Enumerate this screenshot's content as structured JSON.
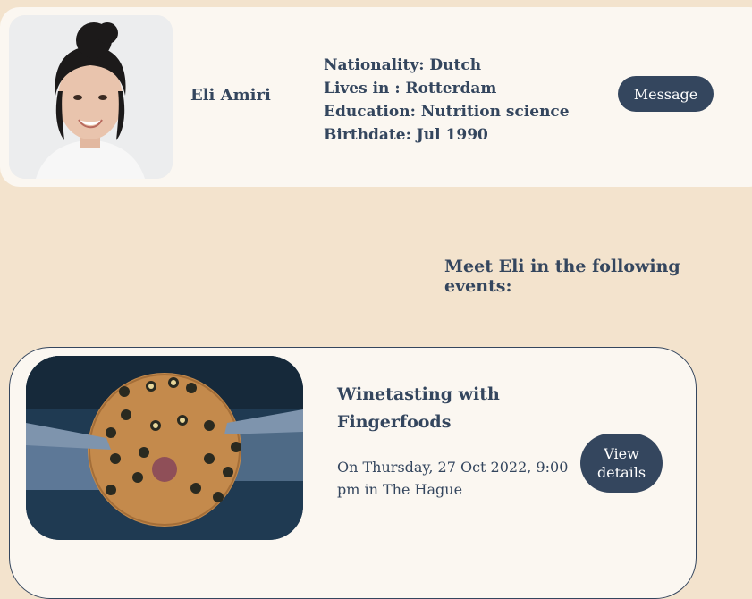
{
  "profile": {
    "name": "Eli Amiri",
    "nationality": "Nationality: Dutch",
    "lives_in": "Lives in : Rotterdam",
    "education": "Education: Nutrition science",
    "birthdate": "Birthdate: Jul 1990",
    "message_label": "Message"
  },
  "events": {
    "heading": "Meet Eli in the following events:",
    "items": [
      {
        "title": "Winetasting with Fingerfoods",
        "when": "On Thursday, 27 Oct 2022, 9:00 pm in The Hague",
        "details_label": "View details"
      }
    ]
  },
  "colors": {
    "page_background": "#f3e3cd",
    "card_background": "#fbf7f1",
    "accent": "#34465e"
  }
}
